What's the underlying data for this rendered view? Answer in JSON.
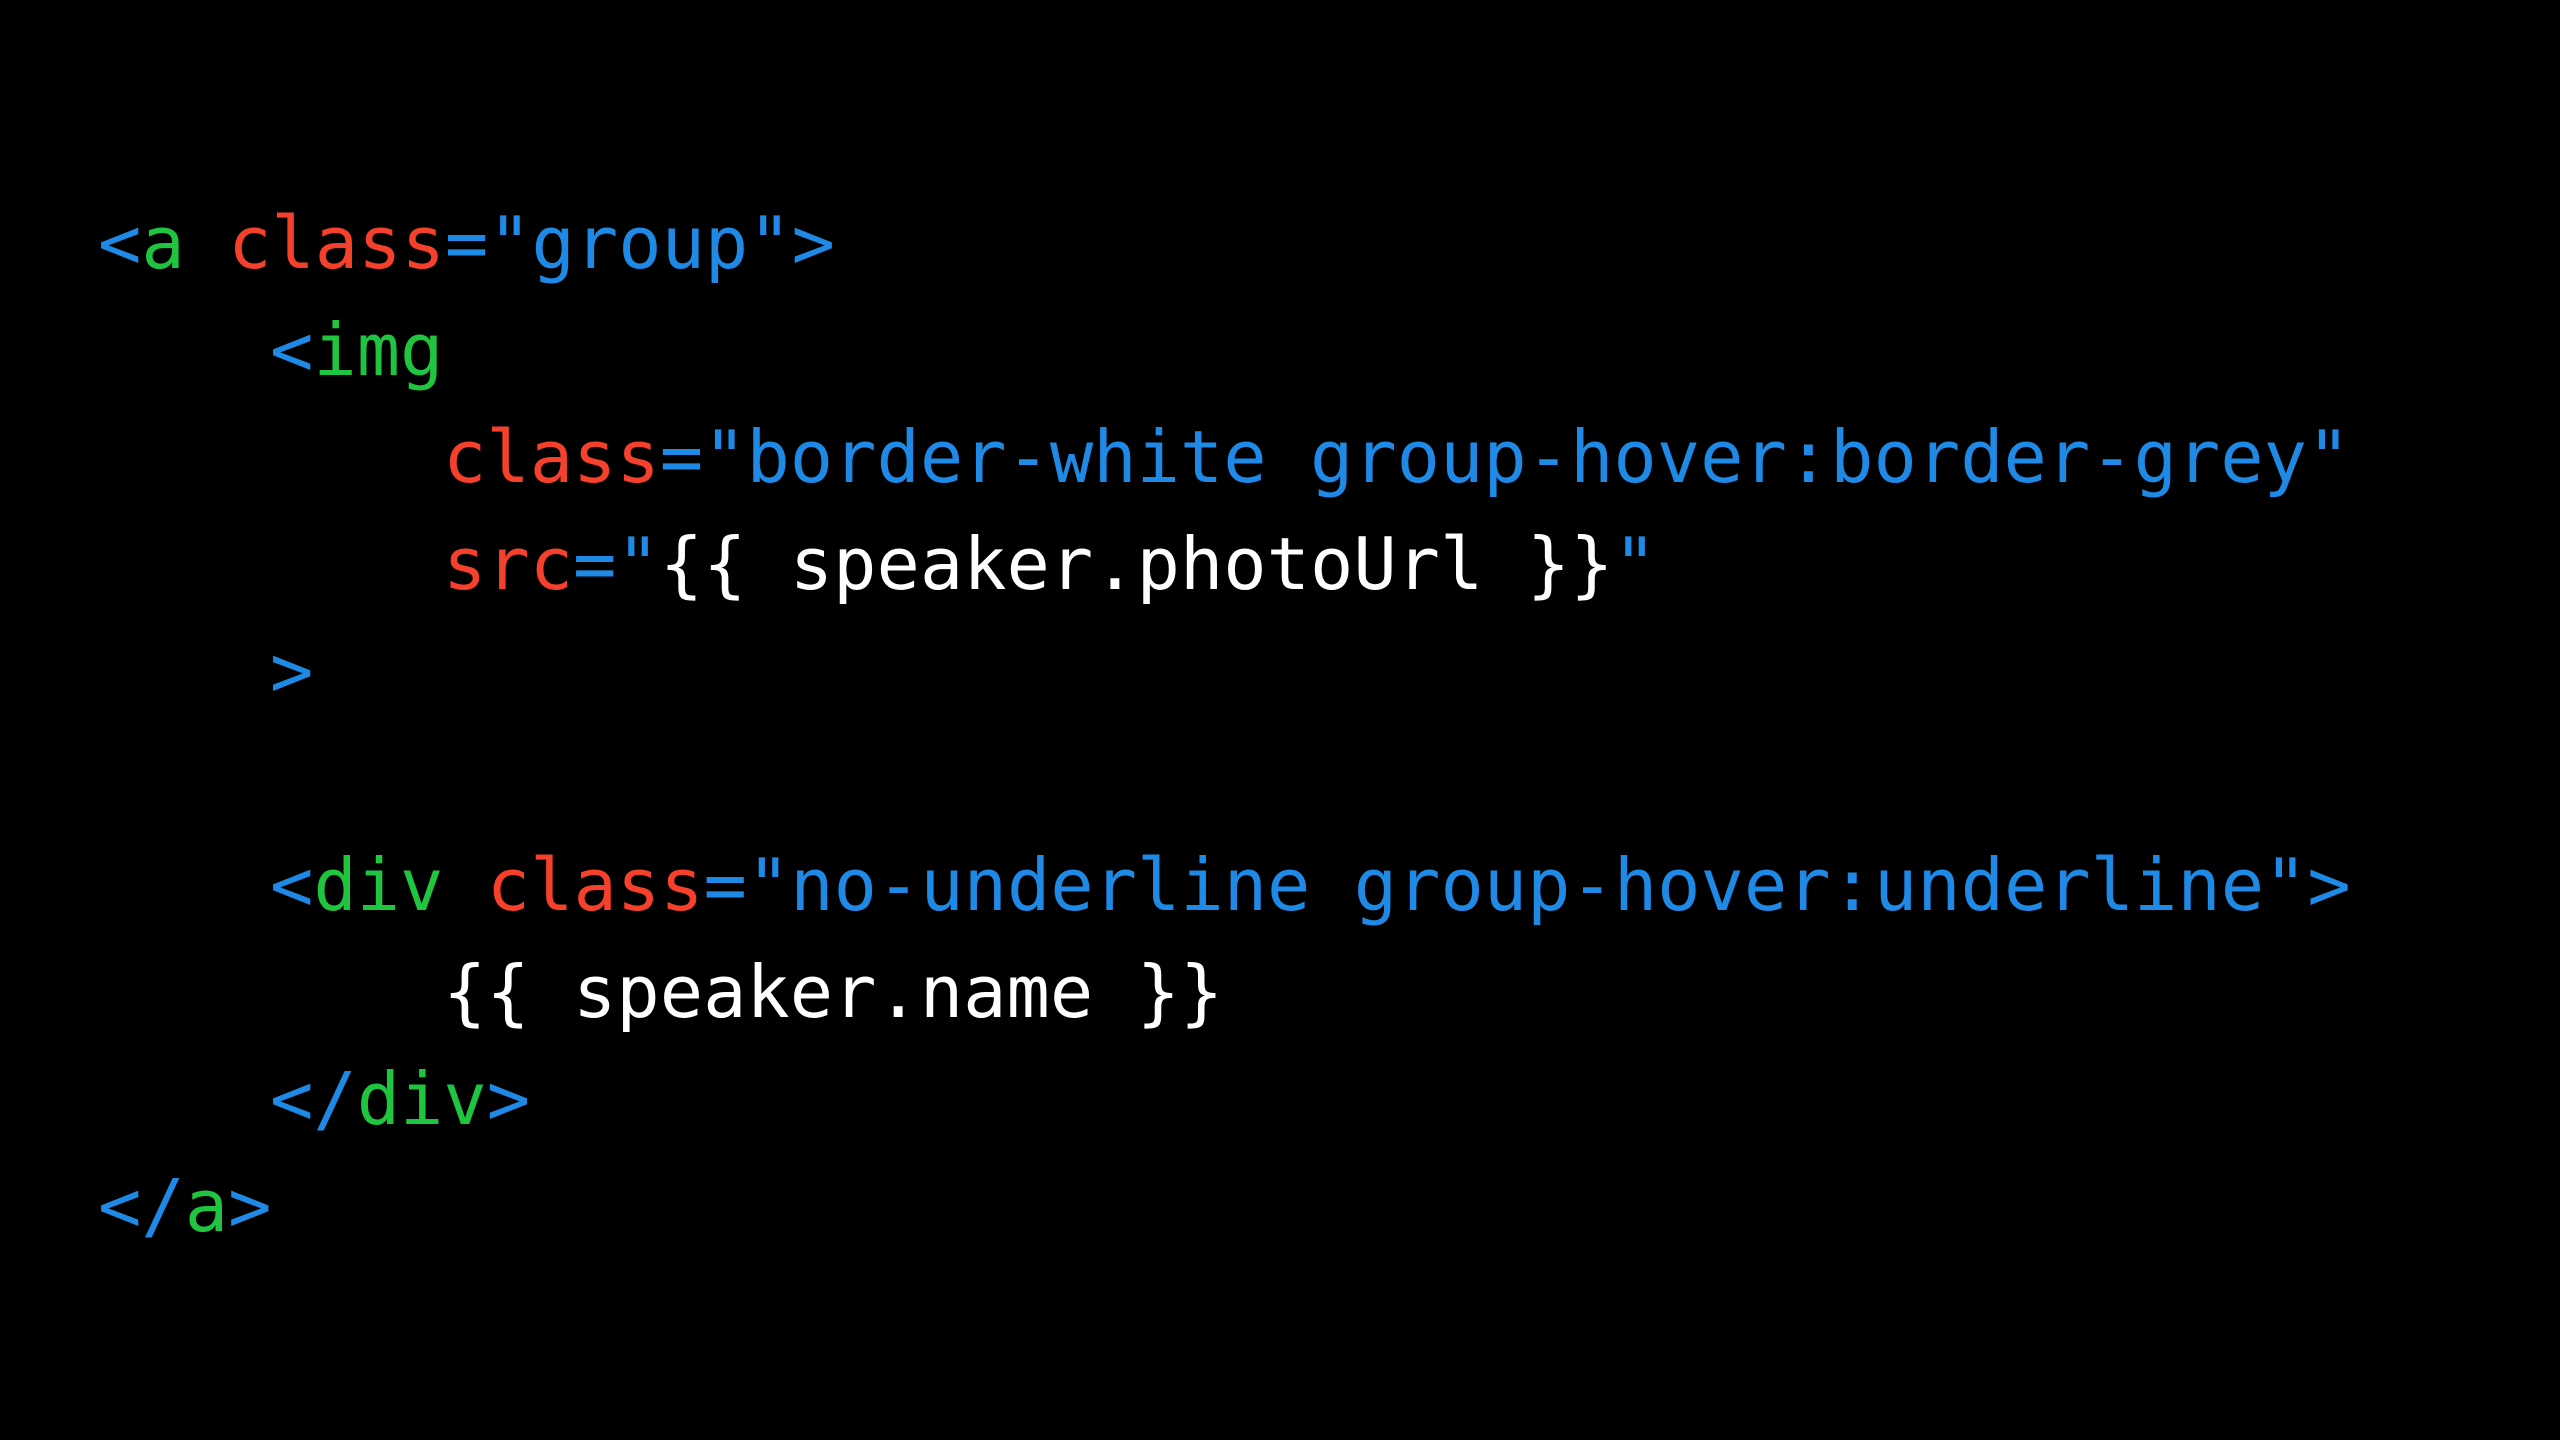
{
  "colors": {
    "background": "#000000",
    "punctuation": "#1E8AE6",
    "tag_name": "#1FC53F",
    "attribute": "#F5402C",
    "string": "#1E8AE6",
    "template_text": "#FFFFFF"
  },
  "code": {
    "line1": {
      "open": "<",
      "tag": "a",
      "space": " ",
      "attr": "class",
      "eq": "=",
      "value": "\"group\"",
      "close": ">"
    },
    "line2": {
      "open": "<",
      "tag": "img"
    },
    "line3": {
      "attr": "class",
      "eq": "=",
      "value": "\"border-white group-hover:border-grey\""
    },
    "line4": {
      "attr": "src",
      "eq": "=",
      "quote_open": "\"",
      "expr": "{{ speaker.photoUrl }}",
      "quote_close": "\""
    },
    "line5": {
      "close": ">"
    },
    "line7": {
      "open": "<",
      "tag": "div",
      "space": " ",
      "attr": "class",
      "eq": "=",
      "value": "\"no-underline group-hover:underline\"",
      "close": ">"
    },
    "line8": {
      "expr": "{{ speaker.name }}"
    },
    "line9": {
      "open": "</",
      "tag": "div",
      "close": ">"
    },
    "line10": {
      "open": "</",
      "tag": "a",
      "close": ">"
    }
  }
}
